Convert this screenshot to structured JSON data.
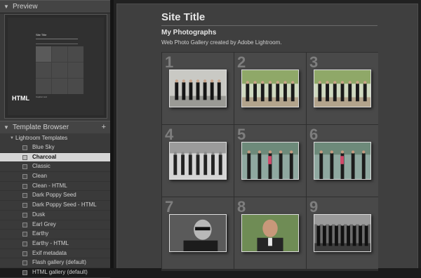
{
  "left_panel": {
    "preview": {
      "header": "Preview",
      "mini_title": "Site Title",
      "mini_caption": "Caption text",
      "badge": "HTML"
    },
    "template_browser": {
      "header": "Template Browser",
      "add_label": "+",
      "folder": "Lightroom Templates",
      "selected_index": 1,
      "items": [
        "Blue Sky",
        "Charcoal",
        "Classic",
        "Clean",
        "Clean - HTML",
        "Dark Poppy Seed",
        "Dark Poppy Seed - HTML",
        "Dusk",
        "Earl Grey",
        "Earthy",
        "Earthy - HTML",
        "Exif metadata",
        "Flash gallery (default)",
        "HTML gallery (default)"
      ]
    }
  },
  "gallery": {
    "site_title": "Site Title",
    "collection_title": "My Photographs",
    "description": "Web Photo Gallery created by Adobe Lightroom.",
    "cells": [
      {
        "number": "1",
        "photo": "group-walking"
      },
      {
        "number": "2",
        "photo": "group-standing-trees"
      },
      {
        "number": "3",
        "photo": "group-standing-trees"
      },
      {
        "number": "4",
        "photo": "group-bw"
      },
      {
        "number": "5",
        "photo": "group-closeup"
      },
      {
        "number": "6",
        "photo": "group-closeup"
      },
      {
        "number": "7",
        "photo": "portrait-sunglasses"
      },
      {
        "number": "8",
        "photo": "portrait-man"
      },
      {
        "number": "9",
        "photo": "group-dark"
      }
    ]
  },
  "colors": {
    "panel_bg": "#3a3a3a",
    "content_bg": "#3f3f3f",
    "selected_item_bg": "#d6d6d6"
  }
}
